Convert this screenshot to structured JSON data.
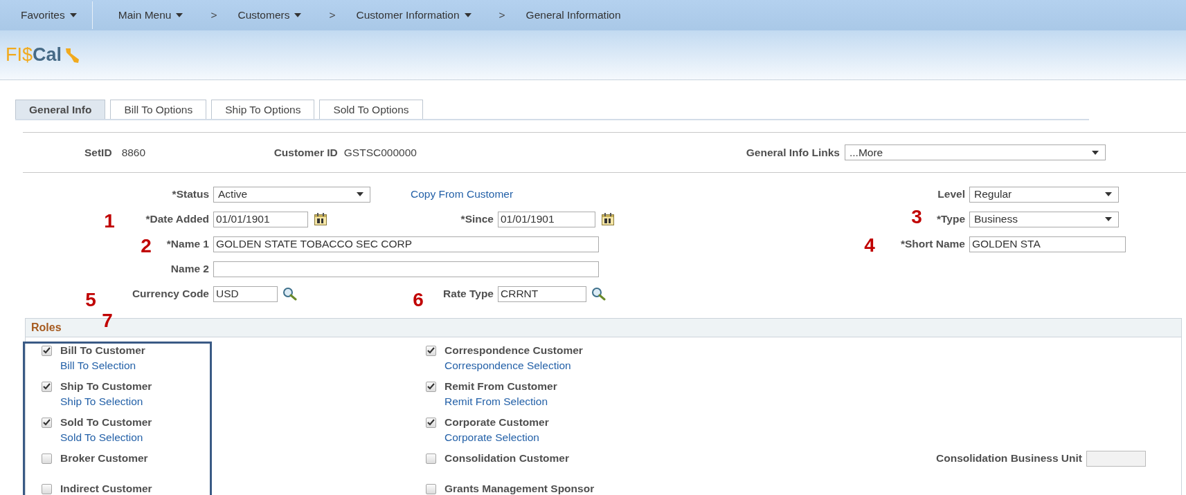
{
  "menu_bar": [
    {
      "kind": "menu",
      "label": "Favorites"
    },
    {
      "kind": "divider"
    },
    {
      "kind": "menu",
      "label": "Main Menu"
    },
    {
      "kind": "separator",
      "text": ">"
    },
    {
      "kind": "menu",
      "label": "Customers"
    },
    {
      "kind": "separator",
      "text": ">"
    },
    {
      "kind": "menu",
      "label": "Customer Information"
    },
    {
      "kind": "separator",
      "text": ">"
    },
    {
      "kind": "page",
      "label": "General Information"
    }
  ],
  "logo": {
    "prefix": "FI$",
    "suffix": "Cal"
  },
  "tabs": [
    {
      "label": "General Info",
      "selected": true
    },
    {
      "label": "Bill To Options",
      "selected": false
    },
    {
      "label": "Ship To Options",
      "selected": false
    },
    {
      "label": "Sold To Options",
      "selected": false
    }
  ],
  "key_fields": [
    {
      "label": "SetID",
      "value": "8860"
    },
    {
      "label": "Customer ID",
      "value": "GSTSC000000"
    }
  ],
  "links_dropdown": {
    "label": "General Info Links",
    "value": "...More"
  },
  "form_rows": [
    {
      "left": {
        "kind": "select",
        "label": "*Status",
        "value": "Active"
      },
      "middle": {
        "kind": "link",
        "label": "Copy From Customer"
      },
      "right": {
        "kind": "select",
        "label": "Level",
        "value": "Regular"
      }
    },
    {
      "left": {
        "kind": "date",
        "label": "*Date Added",
        "value": "01/01/1901"
      },
      "middle": {
        "kind": "date",
        "label": "*Since",
        "value": "01/01/1901"
      },
      "right": {
        "kind": "select",
        "label": "*Type",
        "value": "Business"
      }
    },
    {
      "left": {
        "kind": "text",
        "label": "*Name 1",
        "value": "GOLDEN STATE TOBACCO SEC CORP"
      },
      "right": {
        "kind": "text",
        "label": "*Short Name",
        "value": "GOLDEN STA"
      }
    },
    {
      "left": {
        "kind": "text",
        "label": "Name 2"
      }
    },
    {
      "left": {
        "kind": "lookup",
        "label": "Currency Code",
        "value": "USD"
      },
      "middle": {
        "kind": "lookup",
        "label": "Rate Type",
        "value": "CRRNT"
      }
    }
  ],
  "roles": {
    "title": "Roles",
    "columns": [
      [
        {
          "label": "Bill To Customer",
          "checked": true,
          "link": "Bill To Selection"
        },
        {
          "label": "Ship To Customer",
          "checked": true,
          "link": "Ship To Selection"
        },
        {
          "label": "Sold To Customer",
          "checked": true,
          "link": "Sold To Selection"
        },
        {
          "label": "Broker Customer",
          "checked": false
        },
        {
          "label": "Indirect Customer",
          "checked": false
        }
      ],
      [
        {
          "label": "Correspondence Customer",
          "checked": true,
          "link": "Correspondence Selection"
        },
        {
          "label": "Remit From Customer",
          "checked": true,
          "link": "Remit From Selection"
        },
        {
          "label": "Corporate Customer",
          "checked": true,
          "link": "Corporate Selection"
        },
        {
          "label": "Consolidation Customer",
          "checked": false,
          "field": {
            "label": "Consolidation Business Unit",
            "disabled": true
          }
        },
        {
          "label": "Grants Management Sponsor",
          "checked": false
        }
      ]
    ]
  },
  "annotations": {
    "numbers": [
      "1",
      "2",
      "3",
      "4",
      "5",
      "6",
      "7"
    ],
    "frame_around_left_roles": true
  }
}
